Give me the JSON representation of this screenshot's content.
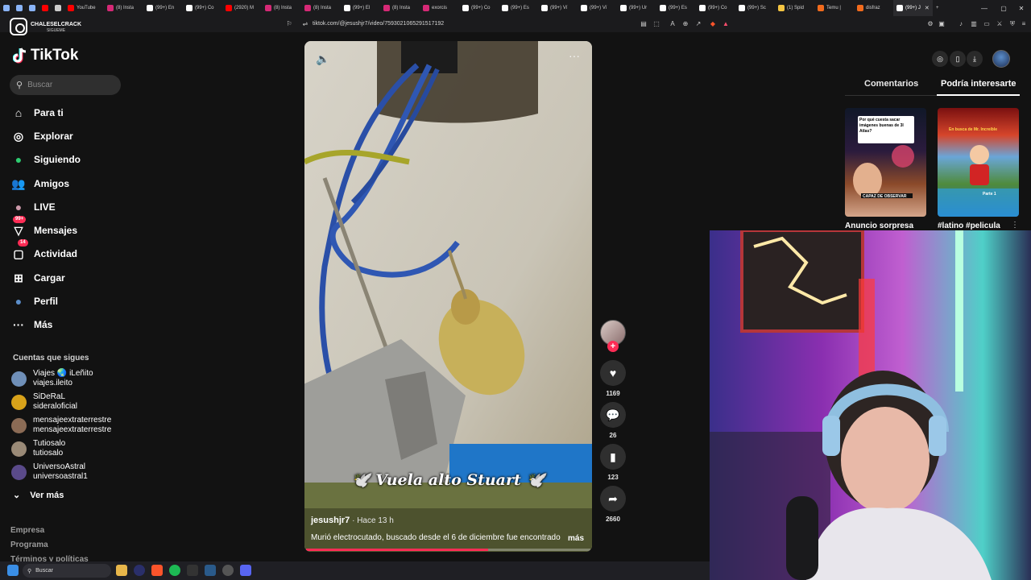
{
  "browser": {
    "tabs": [
      {
        "label": "",
        "color": "#8ab4f8"
      },
      {
        "label": "",
        "color": "#8ab4f8"
      },
      {
        "label": "",
        "color": "#8ab4f8"
      },
      {
        "label": "",
        "color": "#ff0000"
      },
      {
        "label": "",
        "color": "#cccccc"
      },
      {
        "label": "YouTube",
        "color": "#ff0000"
      },
      {
        "label": "(8) Insta",
        "color": "#d62976"
      },
      {
        "label": "(99+) En",
        "color": "#ffffff"
      },
      {
        "label": "(99+) Co",
        "color": "#ffffff"
      },
      {
        "label": "(2920) M",
        "color": "#ff0000"
      },
      {
        "label": "(8) Insta",
        "color": "#d62976"
      },
      {
        "label": "(8) Insta",
        "color": "#d62976"
      },
      {
        "label": "(99+) El",
        "color": "#ffffff"
      },
      {
        "label": "(8) Insta",
        "color": "#d62976"
      },
      {
        "label": "exorcis",
        "color": "#d62976"
      },
      {
        "label": "(99+) Co",
        "color": "#ffffff"
      },
      {
        "label": "(99+) Es",
        "color": "#ffffff"
      },
      {
        "label": "(99+) Ví",
        "color": "#ffffff"
      },
      {
        "label": "(99+) Ví",
        "color": "#ffffff"
      },
      {
        "label": "(99+) Ur",
        "color": "#ffffff"
      },
      {
        "label": "(99+) Es",
        "color": "#ffffff"
      },
      {
        "label": "(99+) Co",
        "color": "#ffffff"
      },
      {
        "label": "(99+) Sc",
        "color": "#ffffff"
      },
      {
        "label": "(1) Spid",
        "color": "#f5c542"
      },
      {
        "label": "Temu |",
        "color": "#f26b1d"
      },
      {
        "label": "disfraz",
        "color": "#f26b1d"
      },
      {
        "label": "(99+) J",
        "color": "#ffffff",
        "active": true
      }
    ],
    "new_tab": "+",
    "url": "tiktok.com/@jesushjr7/video/7593021065291517192"
  },
  "watermark": {
    "name": "CHALESELCRACK",
    "sub": "SIGUEME"
  },
  "sidebar": {
    "logo": "TikTok",
    "search_placeholder": "Buscar",
    "nav": [
      {
        "label": "Para ti",
        "icon": "home-icon",
        "glyph": "⌂"
      },
      {
        "label": "Explorar",
        "icon": "compass-icon",
        "glyph": "◎"
      },
      {
        "label": "Siguiendo",
        "icon": "following-icon",
        "glyph": "●"
      },
      {
        "label": "Amigos",
        "icon": "friends-icon",
        "glyph": "👥"
      },
      {
        "label": "LIVE",
        "icon": "live-icon",
        "glyph": "●"
      },
      {
        "label": "Mensajes",
        "icon": "messages-icon",
        "glyph": "▽",
        "badge": "99+"
      },
      {
        "label": "Actividad",
        "icon": "activity-icon",
        "glyph": "▢",
        "badge": "14"
      },
      {
        "label": "Cargar",
        "icon": "upload-icon",
        "glyph": "⊞"
      },
      {
        "label": "Perfil",
        "icon": "profile-icon",
        "glyph": "●"
      },
      {
        "label": "Más",
        "icon": "more-icon",
        "glyph": "···"
      }
    ],
    "following_header": "Cuentas que sigues",
    "following": [
      {
        "name": "Viajes 🌏 iLeñito",
        "handle": "viajes.ileito",
        "color": "#6f8fb8"
      },
      {
        "name": "SiDeRaL",
        "handle": "sideraloficial",
        "color": "#d8a21a"
      },
      {
        "name": "mensajeextraterrestre",
        "handle": "mensajeextraterrestre",
        "color": "#8b6b55"
      },
      {
        "name": "Tutiosalo",
        "handle": "tutiosalo",
        "color": "#9a8a77"
      },
      {
        "name": "UniversoAstral",
        "handle": "universoastral1",
        "color": "#5a4a8a"
      }
    ],
    "see_more": "Ver más",
    "footer": [
      "Empresa",
      "Programa",
      "Términos y políticas"
    ]
  },
  "video": {
    "overlay_text": "🕊️ Vuela alto Stuart 🕊️",
    "author": "jesushjr7",
    "time": " · Hace 13 h",
    "description": "Murió electrocutado, buscado desde el 6 de diciembre fue encontrado",
    "more": "más",
    "progress": 0.64
  },
  "actions": {
    "likes": "1169",
    "comments": "26",
    "saves": "123",
    "shares": "2660"
  },
  "right_panel": {
    "tabs": [
      "Comentarios",
      "Podría interesarte"
    ],
    "active_tab": 1,
    "thumbs": [
      {
        "caption": "Anuncio sorpresa",
        "headline": "Por qué cuesta sacar imágenes buenas de 3I Atlas?",
        "sub": "CAPAZ DE OBSERVAR"
      },
      {
        "caption": "#latino #pelicula",
        "headline": "En busca de Mr. Increíble",
        "sub": "Parte 1"
      }
    ]
  },
  "taskbar": {
    "search": "Buscar"
  }
}
